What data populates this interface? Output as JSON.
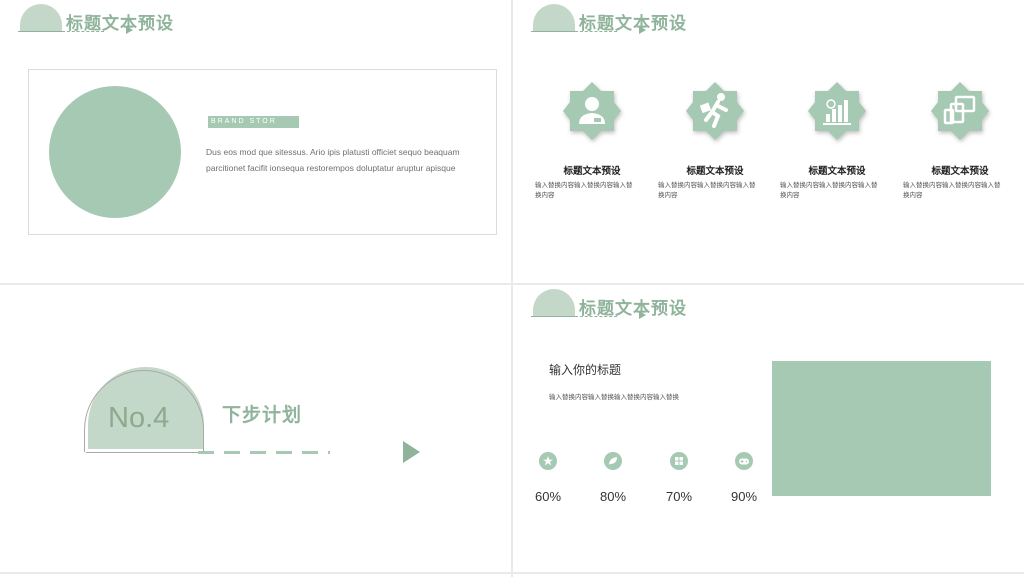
{
  "colors": {
    "accent": "#8fb49b",
    "light": "#c3d8c8",
    "mid": "#a6c9b3"
  },
  "slide1": {
    "header_title": "标题文本预设",
    "brand": "BRAND STOR",
    "description": "Dus eos mod que sitessus. Ario ipis platusti officiet sequo beaquam parcitionet facifit ionsequa restorempos doluptatur aruptur apisque"
  },
  "slide2": {
    "header_title": "标题文本预设",
    "features": [
      {
        "icon": "user-icon",
        "title": "标题文本预设",
        "text": "输入替换内容输入替换内容输入替换内容"
      },
      {
        "icon": "runner-icon",
        "title": "标题文本预设",
        "text": "输入替换内容输入替换内容输入替换内容"
      },
      {
        "icon": "bar-chart-icon",
        "title": "标题文本预设",
        "text": "输入替换内容输入替换内容输入替换内容"
      },
      {
        "icon": "devices-icon",
        "title": "标题文本预设",
        "text": "输入替换内容输入替换内容输入替换内容"
      }
    ]
  },
  "slide3": {
    "number": "No.4",
    "title": "下步计划"
  },
  "slide4": {
    "header_title": "标题文本预设",
    "title": "输入你的标题",
    "subtitle": "输入替换内容输入替换输入替换内容输入替换",
    "stats": [
      {
        "icon": "star-icon",
        "value": "60%"
      },
      {
        "icon": "leaf-icon",
        "value": "80%"
      },
      {
        "icon": "windows-icon",
        "value": "70%"
      },
      {
        "icon": "gamepad-icon",
        "value": "90%"
      }
    ]
  }
}
